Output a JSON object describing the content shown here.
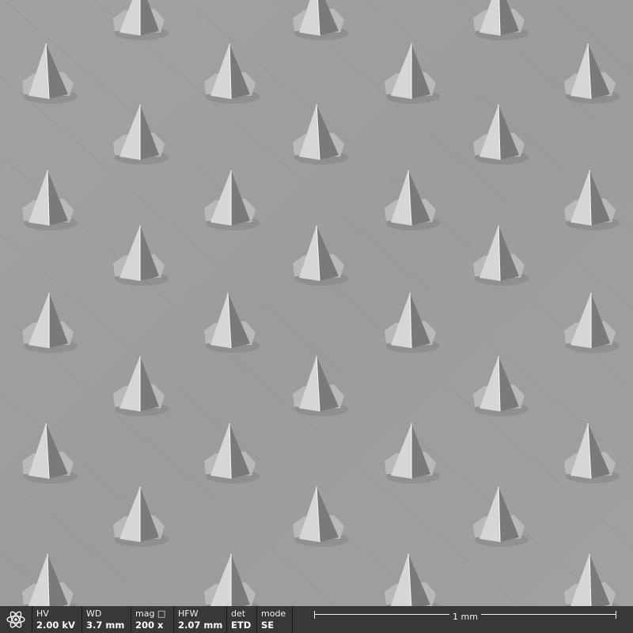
{
  "image": {
    "subject": "microneedle-array",
    "colors": {
      "background": "#9f9f9f",
      "needle_light": "#d8d8d8",
      "needle_dark": "#6e6e6e",
      "infobar": "#383838"
    }
  },
  "infobar": {
    "logo_icon": "atom-icon",
    "fields": [
      {
        "label": "HV",
        "value": "2.00 kV"
      },
      {
        "label": "WD",
        "value": "3.7 mm"
      },
      {
        "label": "mag □",
        "value": "200 x"
      },
      {
        "label": "HFW",
        "value": "2.07 mm"
      },
      {
        "label": "det",
        "value": "ETD"
      },
      {
        "label": "mode",
        "value": "SE"
      }
    ],
    "scale_label": "1 mm"
  }
}
